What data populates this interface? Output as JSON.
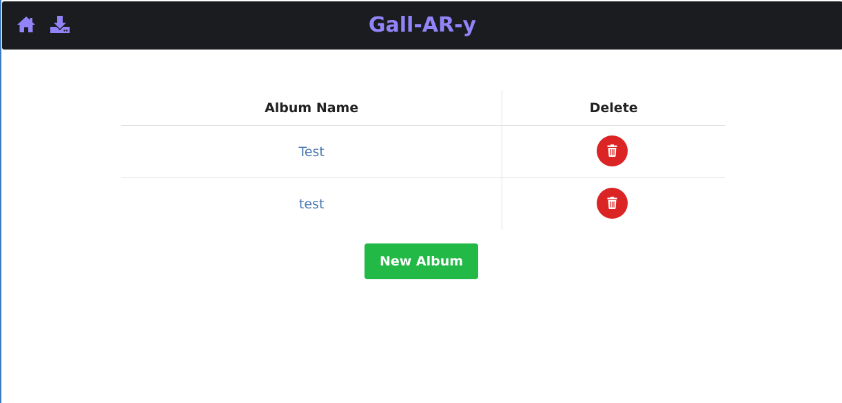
{
  "header": {
    "title": "Gall-AR-y",
    "home_icon": "home-icon",
    "download_icon": "download-icon",
    "background_color": "#1b1c1f",
    "accent_color": "#9284f8"
  },
  "table": {
    "headers": {
      "album_name": "Album Name",
      "delete": "Delete"
    },
    "rows": [
      {
        "name": "Test",
        "delete_icon": "trash-icon"
      },
      {
        "name": "test",
        "delete_icon": "trash-icon"
      }
    ],
    "link_color": "#4978b0",
    "delete_color": "#db2424"
  },
  "actions": {
    "new_album_label": "New Album",
    "new_album_color": "#22b946"
  }
}
